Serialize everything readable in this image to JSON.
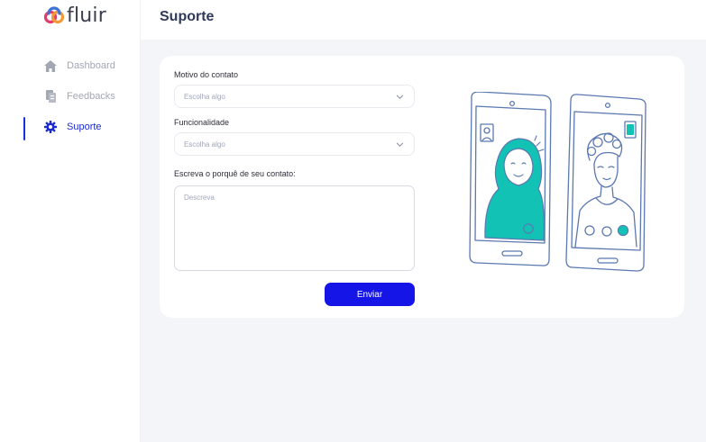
{
  "brand": {
    "name": "fluir",
    "colors": {
      "accent": "#1515e8",
      "logo_pink": "#e23b6d",
      "logo_orange": "#f29a38",
      "logo_blue": "#3d73d6"
    }
  },
  "sidebar": {
    "items": [
      {
        "label": "Dashboard",
        "icon": "home-icon",
        "active": false
      },
      {
        "label": "Feedbacks",
        "icon": "feedback-icon",
        "active": false
      },
      {
        "label": "Suporte",
        "icon": "gear-icon",
        "active": true
      }
    ]
  },
  "header": {
    "title": "Suporte"
  },
  "form": {
    "motivo": {
      "label": "Motivo do contato",
      "value": "Escolha algo"
    },
    "funcionalidade": {
      "label": "Funcionalidade",
      "value": "Escolha algo"
    },
    "mensagem": {
      "label": "Escreva o porquê de seu contato:",
      "placeholder": "Descreva"
    },
    "submit_label": "Enviar"
  },
  "illustration": {
    "name": "video-call-illustration",
    "accent": "#12c2b4",
    "line": "#5b78b0"
  }
}
